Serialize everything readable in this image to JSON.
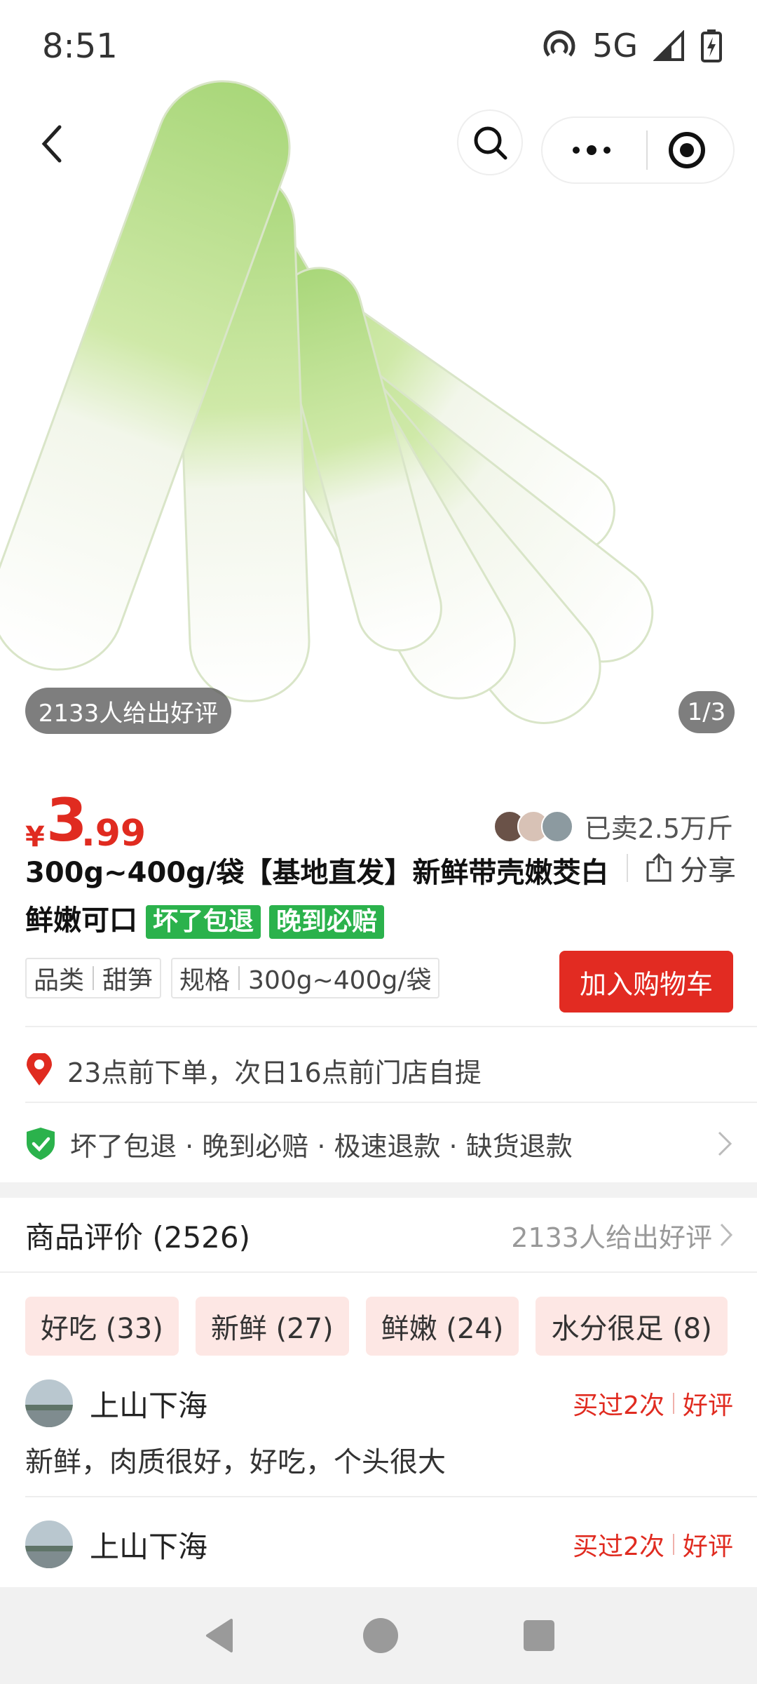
{
  "status_bar": {
    "time": "8:51",
    "network": "5G"
  },
  "hero": {
    "rating_pill": "2133人给出好评",
    "page_indicator": "1/3"
  },
  "price": {
    "currency": "¥",
    "integer": "3",
    "decimal": ".99"
  },
  "sold": {
    "text": "已卖2.5万斤"
  },
  "title": {
    "text": "300g~400g/袋【基地直发】新鲜带壳嫩茭白鲜嫩可口",
    "tags": [
      "坏了包退",
      "晚到必赔"
    ]
  },
  "share": {
    "label": "分享"
  },
  "attributes": [
    {
      "key": "品类",
      "value": "甜笋"
    },
    {
      "key": "规格",
      "value": "300g~400g/袋"
    }
  ],
  "cart_button": {
    "label": "加入购物车"
  },
  "delivery": {
    "text": "23点前下单，次日16点前门店自提"
  },
  "guarantee": {
    "text": "坏了包退 · 晚到必赔 · 极速退款 · 缺货退款"
  },
  "reviews_section": {
    "title": "商品评价 (2526)",
    "summary": "2133人给出好评"
  },
  "review_tags": [
    "好吃 (33)",
    "新鲜 (27)",
    "鲜嫩 (24)",
    "水分很足 (8)"
  ],
  "reviews": [
    {
      "name": "上山下海",
      "bought": "买过2次",
      "rating": "好评",
      "text": "新鲜，肉质很好，好吃，个头很大"
    },
    {
      "name": "上山下海",
      "bought": "买过2次",
      "rating": "好评",
      "text": ""
    }
  ],
  "colors": {
    "accent_red": "#e02b20",
    "green_tag": "#2bb24c",
    "chip_bg": "#fde7e4"
  }
}
